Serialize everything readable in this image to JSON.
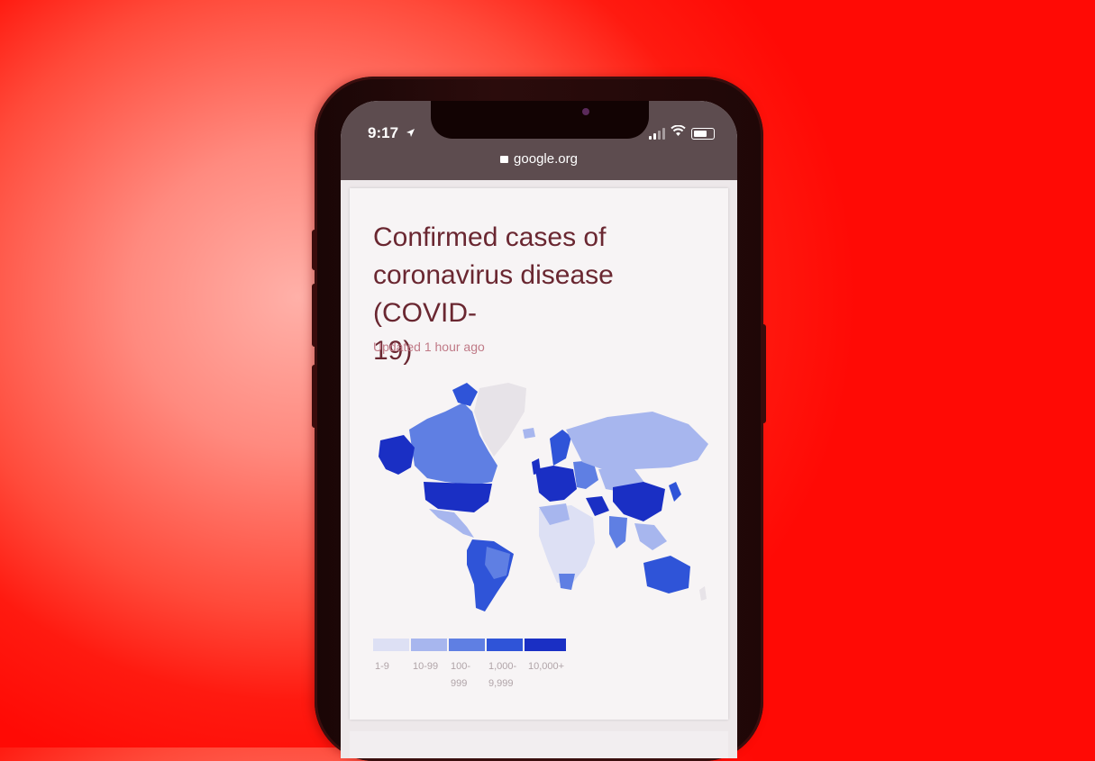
{
  "status_bar": {
    "time": "9:17",
    "location_icon": "location-arrow-icon",
    "signal_icon": "cellular-signal-icon",
    "wifi_icon": "wifi-icon",
    "battery_icon": "battery-icon"
  },
  "browser": {
    "lock_icon": "lock-icon",
    "url": "google.org"
  },
  "card": {
    "title": "Confirmed cases of coronavirus disease (COVID-19)",
    "title_lines": [
      "Confirmed cases of",
      "coronavirus disease (COVID-",
      "19)"
    ],
    "updated": "Updated 1 hour ago"
  },
  "legend": {
    "items": [
      {
        "label_lines": [
          "1-9"
        ],
        "color": "#dde0f4"
      },
      {
        "label_lines": [
          "10-99"
        ],
        "color": "#a7b6ee"
      },
      {
        "label_lines": [
          "100-",
          "999"
        ],
        "color": "#5f7fe3"
      },
      {
        "label_lines": [
          "1,000-",
          "9,999"
        ],
        "color": "#2f54d8"
      },
      {
        "label_lines": [
          "10,000+"
        ],
        "color": "#1a2fc4"
      }
    ]
  },
  "colors": {
    "background_red": "#ff1a10",
    "title_text": "#6a2731",
    "map_grey": "#e7e3e8"
  }
}
